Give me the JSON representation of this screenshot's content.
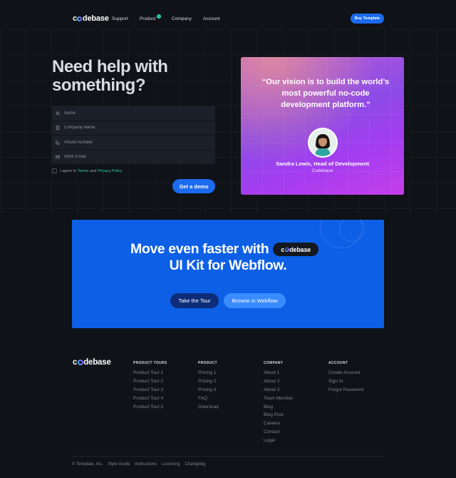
{
  "brand": {
    "logo_text_pre": "c",
    "logo_text_post": "debase"
  },
  "nav": {
    "links": [
      "Support",
      "Product",
      "Company",
      "Account"
    ],
    "product_badge": "+",
    "buy_button": "Buy Template"
  },
  "hero": {
    "title_line1": "Need help with",
    "title_line2": "something?",
    "form": {
      "fields": [
        {
          "placeholder": "Name",
          "icon": "user-icon"
        },
        {
          "placeholder": "Company Name",
          "icon": "building-icon"
        },
        {
          "placeholder": "Phone Number",
          "icon": "phone-icon"
        },
        {
          "placeholder": "Work Email",
          "icon": "mail-icon"
        }
      ],
      "agree_prefix": "I agree to",
      "terms_link": "Terms",
      "agree_and": "and",
      "privacy_link": "Privacy Policy",
      "submit": "Get a demo"
    }
  },
  "testimonial": {
    "quote": "“Our vision is to build the world’s most powerful no-code development platform.”",
    "name": "Sandra Lewis, Head of Development",
    "company": "Codebase"
  },
  "cta": {
    "line1": "Move even faster with",
    "line2": "UI Kit for Webflow.",
    "tour_button": "Take the Tour",
    "browse_button": "Browse in Webflow"
  },
  "footer": {
    "columns": [
      {
        "heading": "PRODUCT TOURS",
        "links": [
          "Product Tour 1",
          "Product Tour 2",
          "Product Tour 3",
          "Product Tour 4",
          "Product Tour 5"
        ]
      },
      {
        "heading": "PRODUCT",
        "links": [
          "Pricing 1",
          "Pricing 2",
          "Pricing 3",
          "FAQ",
          "Download"
        ]
      },
      {
        "heading": "COMPANY",
        "links": [
          "About 1",
          "About 2",
          "About 3",
          "Team Member",
          "Blog",
          "Blog Post",
          "Careers",
          "Contact",
          "Legal"
        ]
      },
      {
        "heading": "ACCOUNT",
        "links": [
          "Create Account",
          "Sign In",
          "Forgot Password"
        ]
      }
    ],
    "bottom": [
      "© Template, Inc.",
      "Style Guide",
      "Instructions",
      "Licensing",
      "Changelog"
    ]
  },
  "colors": {
    "background": "#0f1217",
    "accent_blue": "#1b6bf0",
    "accent_teal": "#29d1ae",
    "cta_blue": "#0d5fe6"
  }
}
